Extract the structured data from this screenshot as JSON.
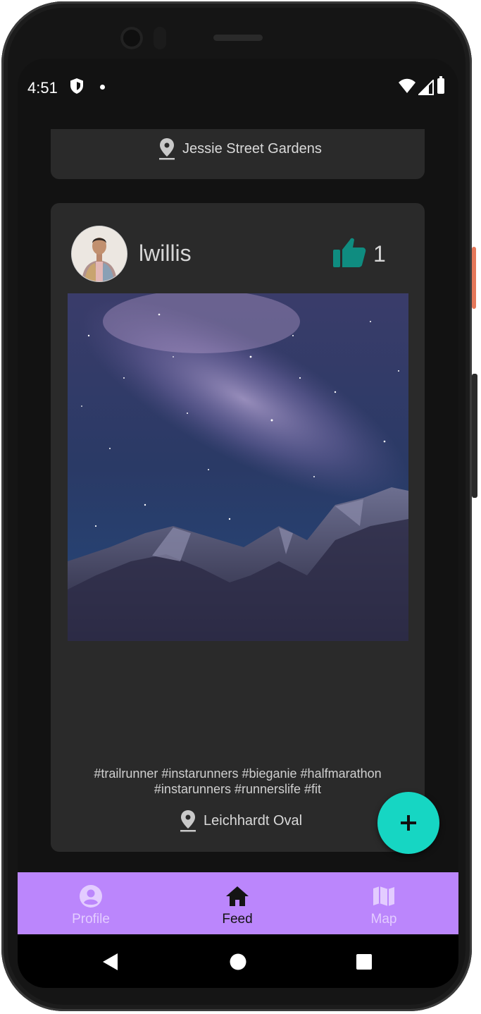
{
  "status_bar": {
    "time": "4:51"
  },
  "feed": {
    "previous_post": {
      "location": "Jessie Street Gardens"
    },
    "post": {
      "username": "lwillis",
      "likes": "1",
      "caption": "#trailrunner #instarunners #bieganie #halfmarathon #instarunners #runnerslife #fit",
      "location": "Leichhardt Oval"
    }
  },
  "fab": {
    "icon": "plus-icon"
  },
  "bottom_nav": {
    "items": [
      {
        "label": "Profile",
        "icon": "account-circle-icon"
      },
      {
        "label": "Feed",
        "icon": "home-icon",
        "active": true
      },
      {
        "label": "Map",
        "icon": "map-icon"
      }
    ]
  },
  "colors": {
    "background": "#121212",
    "card": "#2a2a2a",
    "accent_like": "#0f8c80",
    "fab": "#16d6c3",
    "nav": "#bb86fc"
  }
}
